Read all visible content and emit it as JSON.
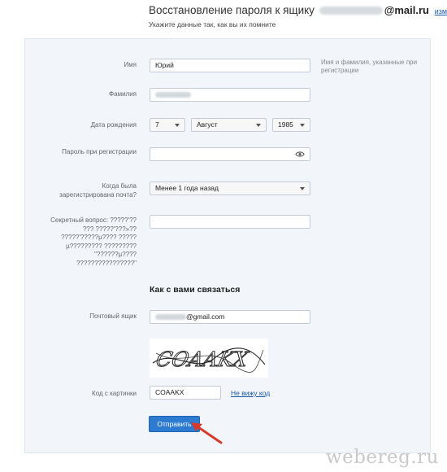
{
  "header": {
    "title_prefix": "Восстановление пароля к ящику",
    "domain": "@mail.ru",
    "change_link": "изменить",
    "subtitle": "Укажите данные так, как вы их помните"
  },
  "form": {
    "first_name": {
      "label": "Имя",
      "value": "Юрий",
      "hint": "Имя и фамилия, указанные при регистрации"
    },
    "last_name": {
      "label": "Фамилия"
    },
    "birth_date": {
      "label": "Дата рождения",
      "day": "7",
      "month": "Август",
      "year": "1985"
    },
    "password": {
      "label": "Пароль при регистрации",
      "value": ""
    },
    "registered": {
      "label": "Когда была зарегистрирована почта?",
      "value": "Менее 1 года назад"
    },
    "secret_question": {
      "label": "Секретный вопрос: ?????'?? ??? ?????'???»?? ?????'?????µ???? ????? µ????????? ????????? \"??????µ???? ????????????????\"",
      "value": ""
    }
  },
  "contact": {
    "section_title": "Как с вами связаться",
    "mailbox": {
      "label": "Почтовый ящик",
      "value_suffix": "@gmail.com"
    },
    "captcha": {
      "label": "Код с картинки",
      "value": "COAAKX",
      "cant_see_link": "Не вижу код",
      "image_text": "COAAKX"
    },
    "submit_label": "Отправить"
  },
  "watermark": "webereg.ru",
  "colors": {
    "panel_bg": "#f2f6fb",
    "link": "#1a5aa6",
    "button": "#2d7bd1",
    "arrow": "#d63a2c"
  }
}
